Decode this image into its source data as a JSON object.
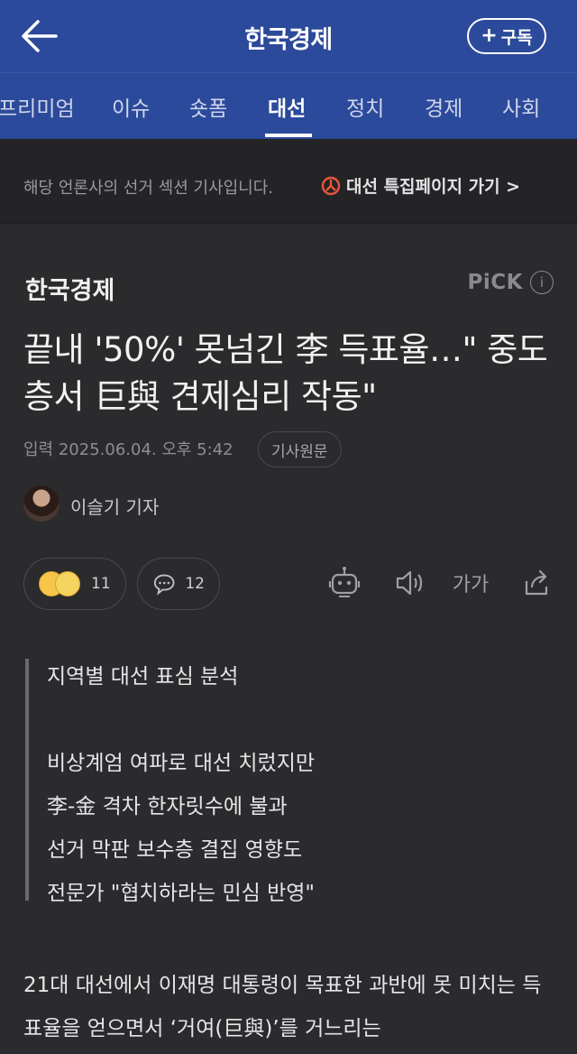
{
  "header": {
    "title": "한국경제",
    "subscribe_label": "구독"
  },
  "tabs": [
    {
      "label": "프리미엄"
    },
    {
      "label": "이슈"
    },
    {
      "label": "숏폼"
    },
    {
      "label": "대선",
      "active": true
    },
    {
      "label": "정치"
    },
    {
      "label": "경제"
    },
    {
      "label": "사회"
    }
  ],
  "notice": {
    "text": "해당 언론사의 선거 섹션 기사입니다.",
    "link": "대선 특집페이지 가기 >"
  },
  "article": {
    "press": "한국경제",
    "pick": "PiCK",
    "headline": "끝내 '50%' 못넘긴 李 득표율…\" 중도층서 巨與 견제심리 작동\"",
    "dateline": "입력 2025.06.04. 오후 5:42",
    "original_button": "기사원문",
    "reporter": "이슬기 기자",
    "reaction_count": "11",
    "comment_count": "12",
    "font_size_label": "가가",
    "summary": [
      "지역별 대선 표심 분석",
      "",
      "비상계엄 여파로 대선 치렀지만",
      "李-金 격차 한자릿수에 불과",
      "선거 막판 보수층 결집 영향도",
      "전문가 \"협치하라는 민심 반영\""
    ],
    "body": "21대 대선에서 이재명 대통령이 목표한 과반에 못 미치는 득표율을 얻으면서 ‘거여(巨與)’를 거느리는"
  },
  "colors": {
    "header_bg": "#2c4a9b",
    "page_bg": "#2b2b2d"
  }
}
